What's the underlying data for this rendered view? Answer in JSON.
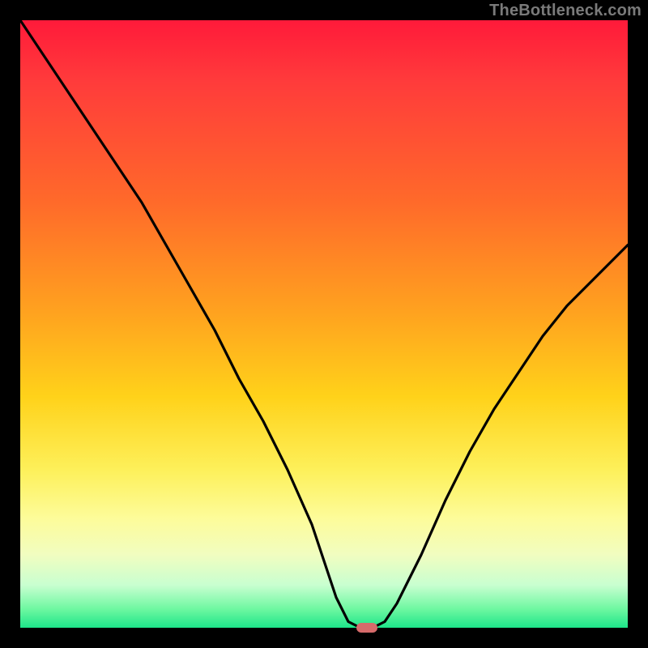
{
  "attribution": "TheBottleneck.com",
  "colors": {
    "page_bg": "#000000",
    "curve_stroke": "#000000",
    "marker_fill": "#d66b6b",
    "gradient_stops": [
      "#ff1a3a",
      "#ff3b3b",
      "#ff6a2a",
      "#ffa21f",
      "#ffd21a",
      "#fdf05a",
      "#fdfc9a",
      "#f1fdc0",
      "#c8ffd0",
      "#6cf7a0",
      "#1de58a"
    ]
  },
  "chart_data": {
    "type": "line",
    "title": "",
    "xlabel": "",
    "ylabel": "",
    "xlim": [
      0,
      100
    ],
    "ylim": [
      0,
      100
    ],
    "series": [
      {
        "name": "bottleneck-curve",
        "x": [
          0,
          4,
          8,
          12,
          16,
          20,
          24,
          28,
          32,
          36,
          40,
          44,
          48,
          50,
          52,
          54,
          56,
          58,
          60,
          62,
          66,
          70,
          74,
          78,
          82,
          86,
          90,
          94,
          98,
          100
        ],
        "y": [
          100,
          94,
          88,
          82,
          76,
          70,
          63,
          56,
          49,
          41,
          34,
          26,
          17,
          11,
          5,
          1,
          0,
          0,
          1,
          4,
          12,
          21,
          29,
          36,
          42,
          48,
          53,
          57,
          61,
          63
        ]
      }
    ],
    "marker": {
      "x": 57,
      "y": 0
    }
  }
}
